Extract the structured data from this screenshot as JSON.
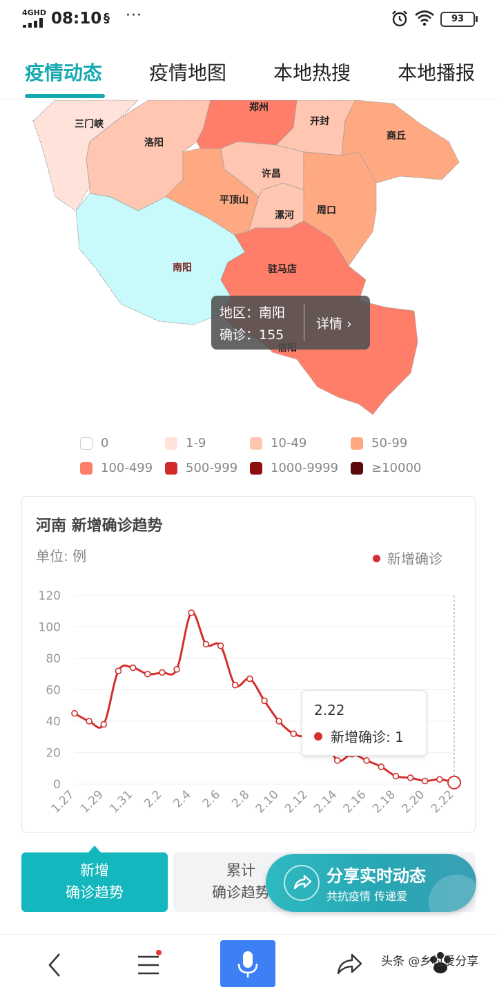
{
  "status_bar": {
    "network": "4GHD",
    "time": "08:10",
    "dots": "···",
    "battery": "93"
  },
  "tabs": [
    {
      "label": "疫情动态",
      "active": true
    },
    {
      "label": "疫情地图",
      "active": false
    },
    {
      "label": "本地热搜",
      "active": false
    },
    {
      "label": "本地播报",
      "active": false
    }
  ],
  "map": {
    "cities": {
      "sanmenxia": "三门峡",
      "zhengzhou": "郑州",
      "kaifeng": "开封",
      "shangqiu": "商丘",
      "luoyang": "洛阳",
      "xuchang": "许昌",
      "pingdingshan": "平顶山",
      "luohe": "漯河",
      "zhoukou": "周口",
      "nanyang": "南阳",
      "zhumadian": "驻马店",
      "xinyang": "信阳"
    },
    "tooltip": {
      "region": "地区：南阳",
      "confirmed": "确诊：155",
      "detail": "详情"
    },
    "colors": {
      "level_0": "#ffffff",
      "level_1": "#ffe3da",
      "level_2": "#ffc7b1",
      "level_3": "#ffa982",
      "level_4": "#ff7e6a",
      "level_5": "#d12c2b",
      "level_6": "#8d0e0e",
      "level_7": "#5a0a0a",
      "selected": "#c8fafb"
    }
  },
  "legend": [
    {
      "label": "0",
      "color": "#ffffff"
    },
    {
      "label": "1-9",
      "color": "#ffe3da"
    },
    {
      "label": "10-49",
      "color": "#ffc7b1"
    },
    {
      "label": "50-99",
      "color": "#ffa982"
    },
    {
      "label": "100-499",
      "color": "#ff7e6a"
    },
    {
      "label": "500-999",
      "color": "#d12c2b"
    },
    {
      "label": "1000-9999",
      "color": "#8d0e0e"
    },
    {
      "label": "≥10000",
      "color": "#5a0a0a"
    }
  ],
  "trend_card": {
    "title": "河南 新增确诊趋势",
    "unit": "单位: 例",
    "legend": "新增确诊",
    "tooltip": {
      "date": "2.22",
      "text": "新增确诊: 1"
    }
  },
  "chart_data": {
    "type": "line",
    "x": [
      "1.27",
      "1.28",
      "1.29",
      "1.30",
      "1.31",
      "2.1",
      "2.2",
      "2.3",
      "2.4",
      "2.5",
      "2.6",
      "2.7",
      "2.8",
      "2.9",
      "2.10",
      "2.11",
      "2.12",
      "2.13",
      "2.14",
      "2.15",
      "2.16",
      "2.17",
      "2.18",
      "2.19",
      "2.20",
      "2.21",
      "2.22"
    ],
    "tick_labels": [
      "1.27",
      "1.29",
      "1.31",
      "2.2",
      "2.4",
      "2.6",
      "2.8",
      "2.10",
      "2.12",
      "2.14",
      "2.16",
      "2.18",
      "2.20",
      "2.22"
    ],
    "series": [
      {
        "name": "新增确诊",
        "values": [
          45,
          40,
          38,
          72,
          74,
          70,
          71,
          73,
          109,
          89,
          88,
          63,
          67,
          53,
          40,
          32,
          30,
          31,
          15,
          19,
          15,
          11,
          5,
          4,
          2,
          3,
          1
        ]
      }
    ],
    "ylim": [
      0,
      120
    ],
    "yticks": [
      0,
      20,
      40,
      60,
      80,
      100,
      120
    ],
    "color": "#d32f2f",
    "grid": true
  },
  "toggles": {
    "new_line1": "新增",
    "new_line2": "确诊趋势",
    "total_line1": "累计",
    "total_line2": "确诊趋势"
  },
  "share": {
    "title": "分享实时动态",
    "subtitle": "共抗疫情 传递爱"
  },
  "bottom_nav": {
    "watermark": "头条 @乡村爱分享"
  }
}
